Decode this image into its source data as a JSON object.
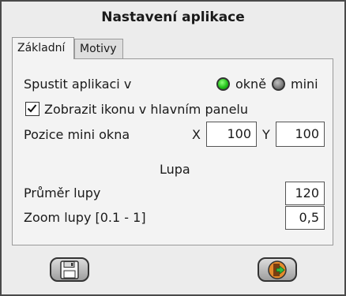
{
  "window": {
    "title": "Nastavení aplikace"
  },
  "tabs": [
    {
      "label": "Základní",
      "active": true
    },
    {
      "label": "Motivy",
      "active": false
    }
  ],
  "settings": {
    "start_label": "Spustit aplikaci v",
    "option_window": "okně",
    "option_mini": "mini",
    "selected": "okně",
    "show_icon_label": "Zobrazit ikonu v hlavním panelu",
    "show_icon_checked": true,
    "mini_pos_label": "Pozice mini okna",
    "x_label": "X",
    "x_value": "100",
    "y_label": "Y",
    "y_value": "100",
    "section_lupa": "Lupa",
    "diameter_label": "Průměr lupy",
    "diameter_value": "120",
    "zoom_label": "Zoom lupy [0.1 - 1]",
    "zoom_value": "0,5"
  },
  "buttons": {
    "save_icon": "floppy-disk-icon",
    "exit_icon": "exit-door-icon"
  },
  "colors": {
    "radio_on": "#23c21a",
    "radio_off": "#7c7c7c",
    "exit_arrow": "#2fbf3f",
    "door": "#b5651d"
  }
}
